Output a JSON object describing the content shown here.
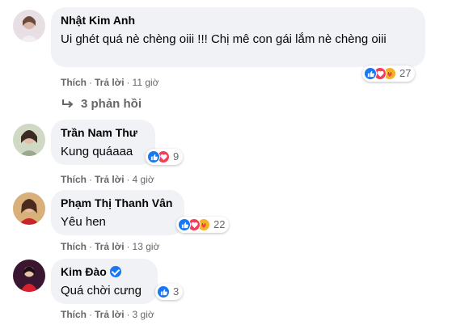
{
  "comments": [
    {
      "author": "Nhật Kim Anh",
      "text": "Ui ghét quá nè chèng oiii !!! Chị mê con gái lắm nè chèng oiii",
      "reaction_count": "27",
      "reactions": [
        "like-icon",
        "love-icon",
        "care-icon"
      ],
      "like": "Thích",
      "reply": "Trả lời",
      "time": "11 giờ",
      "replies_label": "3 phản hồi"
    },
    {
      "author": "Trần Nam Thư",
      "text": "Kung quáaaa",
      "reaction_count": "9",
      "reactions": [
        "like-icon",
        "love-icon"
      ],
      "like": "Thích",
      "reply": "Trả lời",
      "time": "4 giờ"
    },
    {
      "author": "Phạm Thị Thanh Vân",
      "text": "Yêu hen",
      "reaction_count": "22",
      "reactions": [
        "like-icon",
        "love-icon",
        "care-icon"
      ],
      "like": "Thích",
      "reply": "Trả lời",
      "time": "13 giờ"
    },
    {
      "author": "Kim Đào",
      "verified": true,
      "text": "Quá chời cưng",
      "reaction_count": "3",
      "reactions": [
        "like-icon"
      ],
      "like": "Thích",
      "reply": "Trả lời",
      "time": "3 giờ"
    }
  ],
  "colors": {
    "bubble": "#f0f2f5",
    "meta_text": "#65676b",
    "like": "#1877f2",
    "love": "#f33e58",
    "care": "#f7b125"
  }
}
